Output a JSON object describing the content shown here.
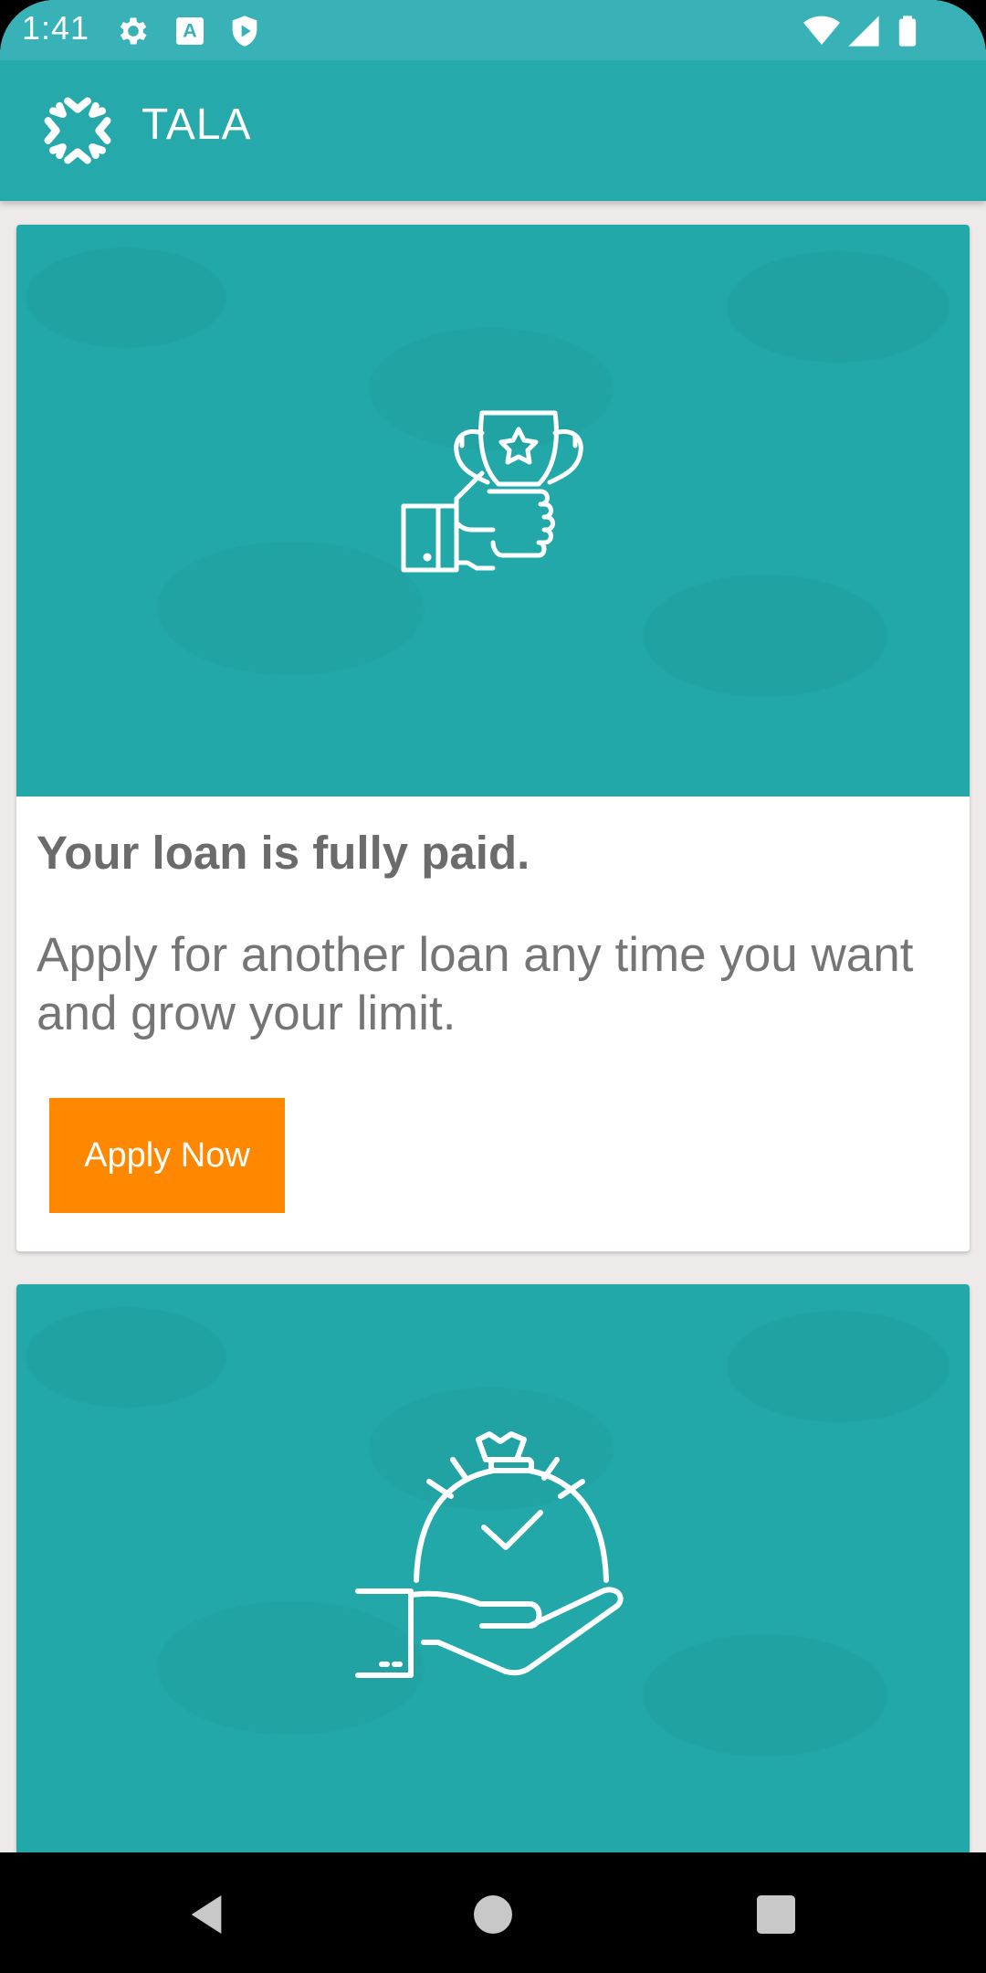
{
  "status_bar": {
    "time": "1:41",
    "icons": [
      "gear-icon",
      "text-a-icon",
      "shield-play-icon",
      "wifi-icon",
      "cellular-signal-icon",
      "battery-icon"
    ]
  },
  "app_bar": {
    "title": "TALA",
    "logo_icon": "tala-logo-icon"
  },
  "cards": [
    {
      "hero_icon": "hand-holding-trophy-icon",
      "title": "Your loan is fully paid.",
      "text": "Apply for another loan any time you want and grow your limit.",
      "button_label": "Apply Now"
    },
    {
      "hero_icon": "hand-holding-money-bag-icon"
    }
  ],
  "nav_bar": {
    "icons": [
      "back-icon",
      "home-icon",
      "recents-icon"
    ]
  },
  "colors": {
    "status_bar": "#38b2b6",
    "app_bar": "#25a9aa",
    "hero": "#22a8a9",
    "accent_button": "#ff8800",
    "text_dark": "#6b6b6b"
  }
}
